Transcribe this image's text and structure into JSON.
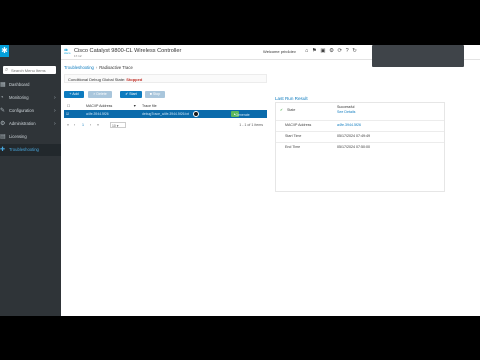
{
  "brand": {
    "logo_text": "cisco",
    "title": "Cisco Catalyst 9800-CL Wireless Controller",
    "version": "17.12"
  },
  "header": {
    "welcome": "Welcome priv4dev"
  },
  "sidebar": {
    "search_placeholder": "Search Menu Items",
    "items": [
      {
        "label": "Dashboard",
        "icon": "dashboard-icon"
      },
      {
        "label": "Monitoring",
        "icon": "monitoring-icon"
      },
      {
        "label": "Configuration",
        "icon": "configuration-icon"
      },
      {
        "label": "Administration",
        "icon": "administration-icon"
      },
      {
        "label": "Licensing",
        "icon": "licensing-icon"
      },
      {
        "label": "Troubleshooting",
        "icon": "troubleshooting-icon",
        "active": true
      }
    ]
  },
  "breadcrumb": {
    "parent": "Troubleshooting",
    "current": "Radioactive Trace"
  },
  "status": {
    "label": "Conditional Debug Global State:",
    "value": "Stopped"
  },
  "toolbar": {
    "add": "Add",
    "delete": "Delete",
    "start": "Start",
    "stop": "Stop"
  },
  "grid": {
    "columns": [
      "MAC/IP Address",
      "Trace file"
    ],
    "rows": [
      {
        "mac": "a4fe.3944.5f26",
        "file": "debugTrace_a4fe.3944.5f26.txt",
        "action": "Generate"
      }
    ],
    "pager": {
      "page": "1",
      "page_size": "10",
      "summary": "1 - 1 of 1 items"
    }
  },
  "last_run": {
    "title": "Last Run Result",
    "rows": [
      {
        "key": "State",
        "value": "Successful",
        "sub": "See Details"
      },
      {
        "key": "MAC/IP Address",
        "value": "a4fe.3944.5f26"
      },
      {
        "key": "Start Time",
        "value": "05/17/2024 07:49:49"
      },
      {
        "key": "End Time",
        "value": "05/17/2024 07:50:00"
      }
    ]
  },
  "colors": {
    "accent": "#049fd9",
    "sidebar": "#2f3438",
    "selected_row": "#0b6bab",
    "success": "#5cb85c",
    "stopped": "#c03028"
  }
}
